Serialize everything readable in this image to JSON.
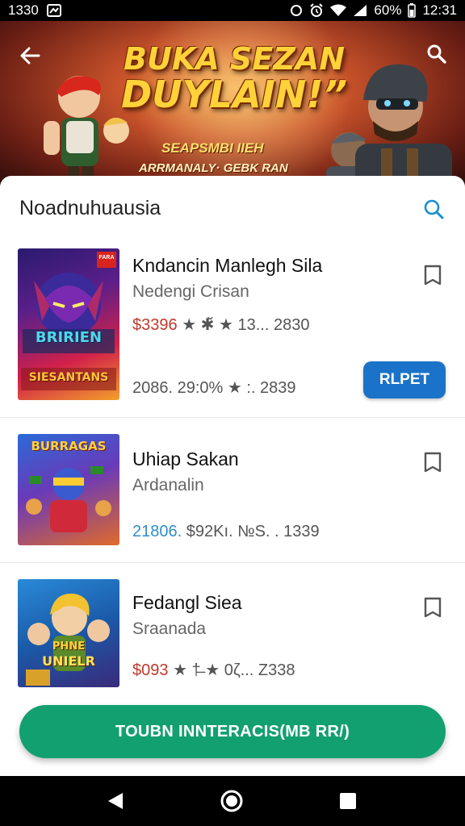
{
  "status_bar": {
    "time_left": "1330",
    "battery": "60%",
    "time_right": "12:31"
  },
  "banner": {
    "title_line1": "BUKA SEZAN",
    "title_line2": "DUYLAIN!”",
    "subtitle": "SEAPSMBI IIEH",
    "tagline": "ARRMANALY· GEBK RAN"
  },
  "sheet": {
    "header": "Noadnuhuausia"
  },
  "cards": [
    {
      "title": "Kndancin Manlegh Sila",
      "subtitle": "Nedengi Crisan",
      "meta_price": "$3396",
      "meta_rest": "★ ✱̆ ★ 13... 2830",
      "meta_line2": "2086.  29:0%  ★ :.  2839",
      "button_label": "RLPET",
      "thumb_text_top": "BRIRIEN",
      "thumb_text_bottom": "SIESANTANS",
      "thumb_badge": "FARA"
    },
    {
      "title": "Uhiap Sakan",
      "subtitle": "Ardanalin",
      "meta_price": "21806.",
      "meta_rest": "$92Kı.  №S. .  1339",
      "thumb_text_top": "BURRAGAS",
      "thumb_text_bottom": ""
    },
    {
      "title": "Fedangl Siea",
      "subtitle": "Sraanada",
      "meta_price": "$093",
      "meta_rest": "★ †̶ ★ 0ζ...  Z338",
      "thumb_text_top": "PHNE",
      "thumb_text_bottom": "UNIELR"
    }
  ],
  "cta": {
    "label": "TOUBN INNTERACIS(MB RR/)"
  },
  "colors": {
    "accent_blue": "#1a73c8",
    "cta_green": "#13a070",
    "price_red": "#c0392b",
    "star_gold": "#f2b21c"
  },
  "icons": [
    "back-arrow-icon",
    "search-icon",
    "bookmark-icon",
    "nav-back-icon",
    "nav-home-icon",
    "nav-recents-icon",
    "wifi-icon",
    "signal-icon",
    "alarm-icon",
    "notification-icon"
  ]
}
